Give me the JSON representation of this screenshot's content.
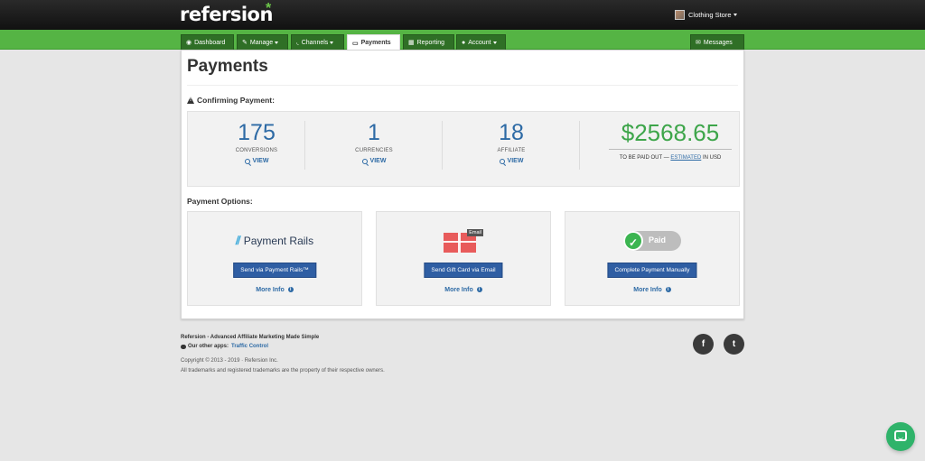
{
  "brand": {
    "logo_text": "refersion",
    "logo_mark": "*"
  },
  "account": {
    "store_name": "Clothing Store"
  },
  "nav": {
    "tabs": [
      {
        "label": "Dashboard",
        "icon": "dashboard-icon"
      },
      {
        "label": "Manage",
        "icon": "edit-icon",
        "dropdown": true
      },
      {
        "label": "Channels",
        "icon": "rss-icon",
        "dropdown": true
      },
      {
        "label": "Payments",
        "icon": "money-icon",
        "active": true
      },
      {
        "label": "Reporting",
        "icon": "chart-icon"
      },
      {
        "label": "Account",
        "icon": "user-icon",
        "dropdown": true
      }
    ],
    "messages_label": "Messages"
  },
  "page": {
    "title": "Payments",
    "confirming_label": "Confirming Payment:",
    "stats": [
      {
        "value": "175",
        "label": "CONVERSIONS",
        "link": "VIEW"
      },
      {
        "value": "1",
        "label": "CURRENCIES",
        "link": "VIEW"
      },
      {
        "value": "18",
        "label": "AFFILIATE",
        "link": "VIEW"
      }
    ],
    "payout": {
      "amount": "$2568.65",
      "note_prefix": "TO BE PAID OUT —",
      "note_link": "ESTIMATED",
      "note_suffix": "IN USD"
    },
    "options_label": "Payment Options:",
    "options": [
      {
        "logo": "Payment Rails",
        "button": "Send via Payment Rails™",
        "more": "More Info"
      },
      {
        "logo_tag": "Email",
        "button": "Send Gift Card via Email",
        "more": "More Info"
      },
      {
        "logo": "Paid",
        "button": "Complete Payment Manually",
        "more": "More Info"
      }
    ]
  },
  "footer": {
    "tagline": "Refersion - Advanced Affiliate Marketing Made Simple",
    "other_apps_label": "Our other apps:",
    "other_apps_link": "Traffic Control",
    "copyright": "Copyright © 2013 - 2019 · Refersion Inc.",
    "trademark": "All trademarks and registered trademarks are the property of their respective owners.",
    "facebook_glyph": "f",
    "twitter_glyph": "t"
  },
  "colors": {
    "nav_green": "#55b444",
    "link_blue": "#2d6aa5",
    "amount_green": "#3da54a",
    "button_blue": "#2f5ea3"
  }
}
